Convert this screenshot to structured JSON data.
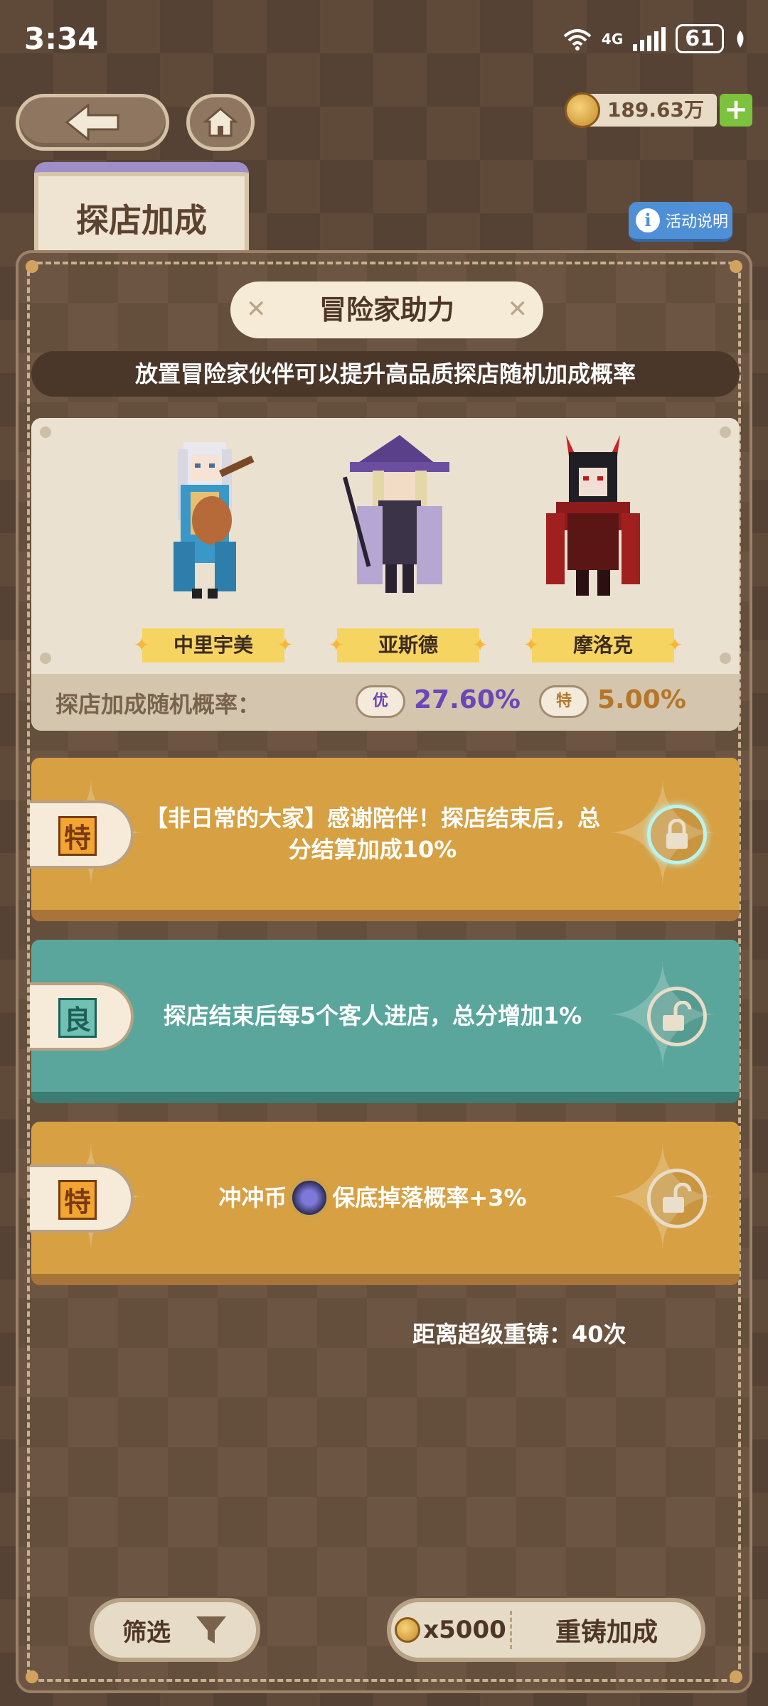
{
  "status_bar": {
    "time": "3:34",
    "network": "4G",
    "battery": "61"
  },
  "top_bar": {
    "currency_value": "189.63万",
    "add_label": "+"
  },
  "tab": {
    "label": "探店加成"
  },
  "info_button": {
    "label": "活动说明",
    "icon_glyph": "i"
  },
  "panel": {
    "section_title": "冒险家助力",
    "subtitle": "放置冒险家伙伴可以提升高品质探店随机加成概率",
    "characters": [
      {
        "name": "中里宇美",
        "icon": "lute-bard-sprite"
      },
      {
        "name": "亚斯德",
        "icon": "witch-sprite"
      },
      {
        "name": "摩洛克",
        "icon": "demon-knight-sprite"
      }
    ],
    "probability": {
      "label": "探店加成随机概率：",
      "items": [
        {
          "badge": "优",
          "value": "27.60%",
          "color": "#6c45b8"
        },
        {
          "badge": "特",
          "value": "5.00%",
          "color": "#b5762a"
        }
      ]
    },
    "bonuses": [
      {
        "grade": "特",
        "text": "【非日常的大家】感谢陪伴！探店结束后，总分结算加成10%",
        "theme": "gold",
        "lock": "locked"
      },
      {
        "grade": "良",
        "text": "探店结束后每5个客人进店，总分增加1%",
        "theme": "teal",
        "lock": "unlocked"
      },
      {
        "grade": "特",
        "text_before": "冲冲币",
        "text_after": "保底掉落概率+3%",
        "theme": "gold",
        "lock": "unlocked"
      }
    ]
  },
  "footer": {
    "reforge_count": "距离超级重铸：40次",
    "filter_label": "筛选",
    "reforge_cost": "x5000",
    "reforge_label": "重铸加成"
  }
}
